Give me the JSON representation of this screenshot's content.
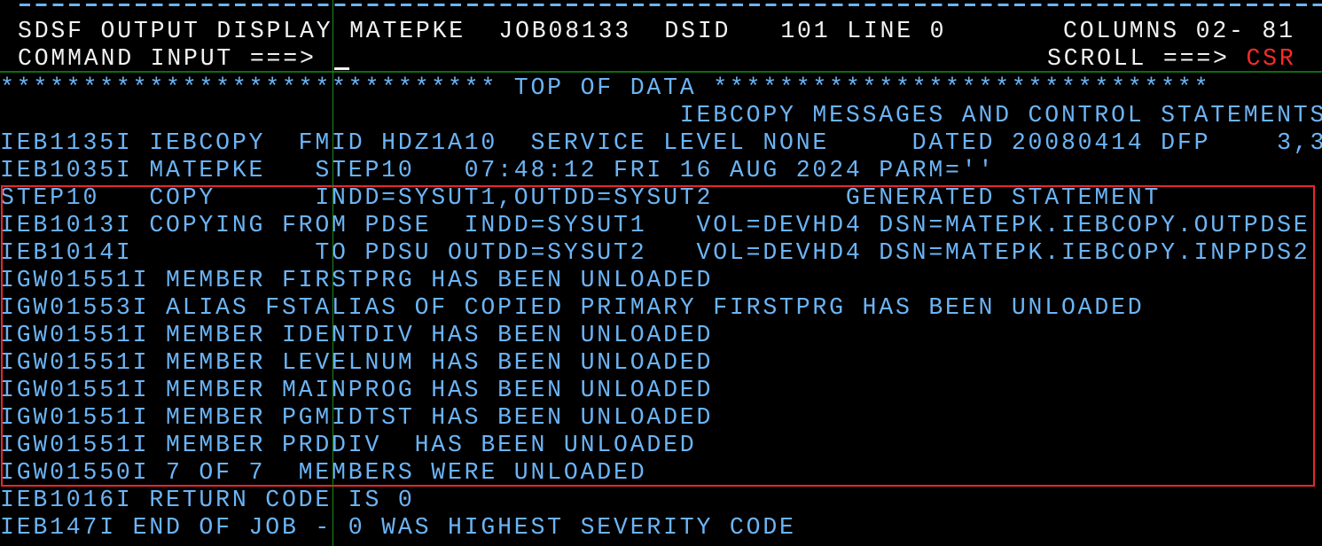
{
  "header": {
    "title": "SDSF OUTPUT DISPLAY",
    "jobname": "MATEPKE",
    "jobid": "JOB08133",
    "dsid_label": "DSID",
    "dsid_value": "101",
    "line_label": "LINE",
    "line_value": "0",
    "columns_label": "COLUMNS",
    "columns_value": "02- 81",
    "command_label": "COMMAND INPUT ===>",
    "command_value": "",
    "scroll_label": "SCROLL ===>",
    "scroll_value": "CSR"
  },
  "colors": {
    "header_text": "#f2f2f2",
    "output_text": "#6cb4f5",
    "scroll_value": "#ff2a2a",
    "highlight_border": "#e8262b",
    "guide_lines": "#1f8a1f",
    "background": "#000000"
  },
  "output": {
    "top_of_data": "****************************** TOP OF DATA ******************************",
    "lines": [
      "                                         IEBCOPY MESSAGES AND CONTROL STATEMENTS",
      "IEB1135I IEBCOPY  FMID HDZ1A10  SERVICE LEVEL NONE     DATED 20080414 DFP    3,3",
      "IEB1035I MATEPKE   STEP10   07:48:12 FRI 16 AUG 2024 PARM=''",
      "STEP10   COPY      INDD=SYSUT1,OUTDD=SYSUT2        GENERATED STATEMENT",
      "IEB1013I COPYING FROM PDSE  INDD=SYSUT1   VOL=DEVHD4 DSN=MATEPK.IEBCOPY.OUTPDSE",
      "IEB1014I           TO PDSU OUTDD=SYSUT2   VOL=DEVHD4 DSN=MATEPK.IEBCOPY.INPPDS2",
      "IGW01551I MEMBER FIRSTPRG HAS BEEN UNLOADED",
      "IGW01553I ALIAS FSTALIAS OF COPIED PRIMARY FIRSTPRG HAS BEEN UNLOADED",
      "IGW01551I MEMBER IDENTDIV HAS BEEN UNLOADED",
      "IGW01551I MEMBER LEVELNUM HAS BEEN UNLOADED",
      "IGW01551I MEMBER MAINPROG HAS BEEN UNLOADED",
      "IGW01551I MEMBER PGMIDTST HAS BEEN UNLOADED",
      "IGW01551I MEMBER PRDDIV  HAS BEEN UNLOADED",
      "IGW01550I 7 OF 7  MEMBERS WERE UNLOADED",
      "IEB1016I RETURN CODE IS 0",
      "IEB147I END OF JOB - 0 WAS HIGHEST SEVERITY CODE"
    ]
  }
}
